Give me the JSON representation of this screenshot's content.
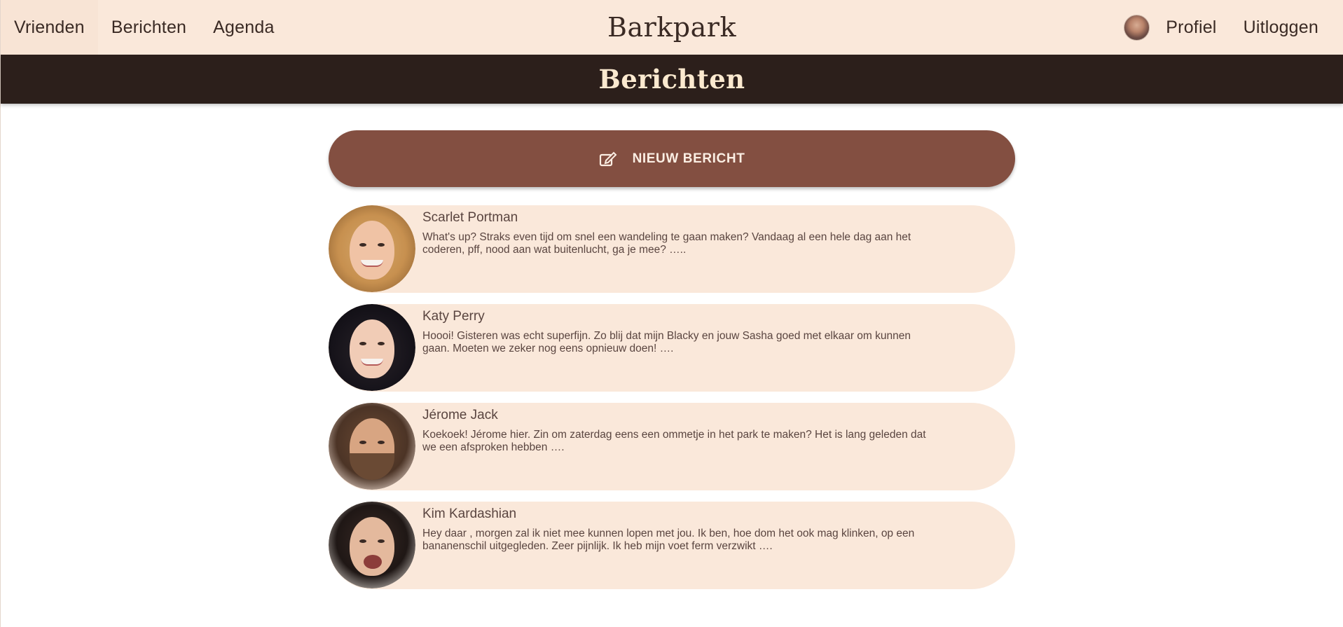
{
  "nav": {
    "left": [
      {
        "label": "Vrienden"
      },
      {
        "label": "Berichten"
      },
      {
        "label": "Agenda"
      }
    ],
    "brand": "Barkpark",
    "right": {
      "profile": "Profiel",
      "logout": "Uitloggen"
    }
  },
  "header": {
    "title": "Berichten"
  },
  "new_message": {
    "label": "NIEUW BERICHT",
    "icon": "edit-icon"
  },
  "messages": [
    {
      "name": "Scarlet Portman",
      "text": "What's up? Straks even tijd om snel een wandeling te gaan maken? Vandaag al een hele dag aan het coderen, pff, nood aan wat buitenlucht, ga je mee? ….."
    },
    {
      "name": "Katy Perry",
      "text": "Hoooi! Gisteren was echt superfijn. Zo blij dat mijn Blacky en jouw Sasha goed met elkaar om kunnen gaan. Moeten we zeker nog eens opnieuw doen! …."
    },
    {
      "name": "Jérome Jack",
      "text": "Koekoek! Jérome hier. Zin om zaterdag eens een ommetje in het park te maken? Het is lang geleden dat we een afsproken hebben …."
    },
    {
      "name": "Kim Kardashian",
      "text": "Hey daar , morgen zal ik niet mee kunnen lopen met jou. Ik ben, hoe dom het ook mag klinken, op een bananenschil uitgegleden. Zeer pijnlijk. Ik heb mijn voet ferm verzwikt …."
    }
  ],
  "colors": {
    "nav_bg": "#fae8da",
    "header_bg": "#2c1f1b",
    "header_text": "#fbe9cf",
    "button_bg": "#834f41",
    "card_bg": "#fae8da"
  }
}
